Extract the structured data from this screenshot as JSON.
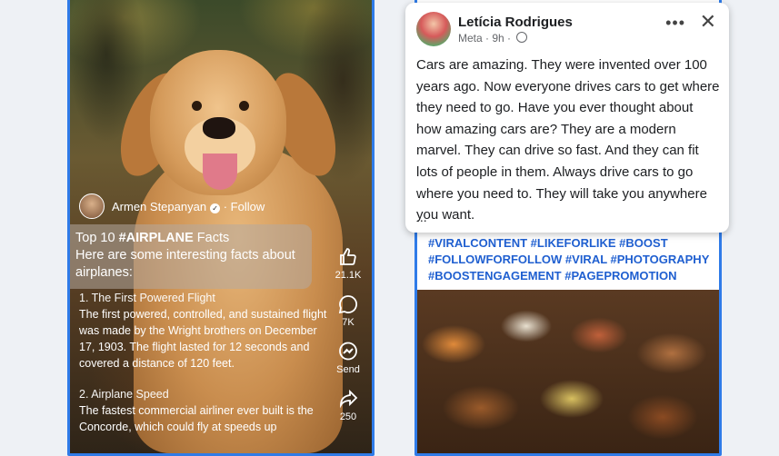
{
  "reel": {
    "author_name": "Armen Stepanyan",
    "follow_label": "Follow",
    "caption_line1_prefix": "Top 10 ",
    "caption_hashtag": "#AIRPLANE",
    "caption_line1_suffix": " Facts",
    "caption_rest": "Here are some interesting facts about airplanes:",
    "fact1_title": "1. The First Powered Flight",
    "fact1_body": "The first powered, controlled, and sustained flight was made by the Wright brothers on December 17, 1903. The flight lasted for 12 seconds and covered a distance of 120 feet.",
    "fact2_title": "2. Airplane Speed",
    "fact2_body": "The fastest commercial airliner ever built is the Concorde, which could fly at speeds up",
    "actions": {
      "like_count": "21.1K",
      "comment_count": "7K",
      "send_label": "Send",
      "share_count": "250"
    }
  },
  "post": {
    "author_name": "Letícia Rodrigues",
    "meta_source": "Meta",
    "meta_time": "9h",
    "body": "Cars are amazing. They were invented over 100 years ago. Now everyone drives cars to get where they need to go. Have you ever thought about how amazing cars are? They are a modern marvel. They can drive so fast. And they can fit lots of people in them. Always drive cars to go where you need to. They will take you anywhere you want.",
    "ellipsis": "...",
    "hashtags": "#VIRALCONTENT #LIKEFORLIKE #BOOST #FOLLOWFORFOLLOW #VIRAL #PHOTOGRAPHY #BOOSTENGAGEMENT #PAGEPROMOTION"
  },
  "icons": [
    "thumbs-up-icon",
    "comment-icon",
    "messenger-icon",
    "share-icon",
    "more-icon",
    "close-icon",
    "globe-icon",
    "verified-icon"
  ],
  "colors": {
    "frame_border": "#2f7be8",
    "hashtag": "#1f5fd0",
    "page_bg": "#eef1f5"
  }
}
